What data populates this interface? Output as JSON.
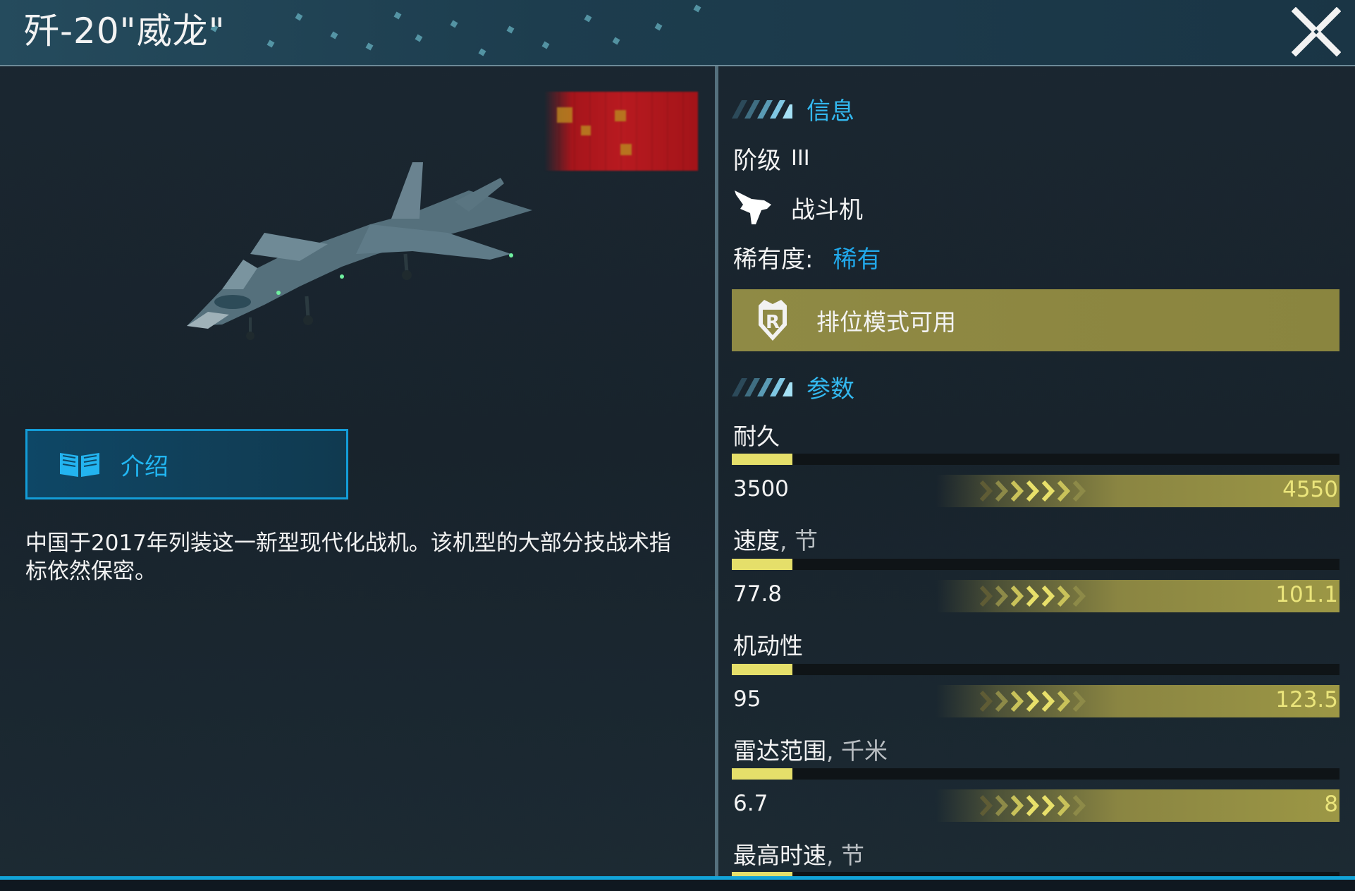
{
  "header": {
    "title": "歼-20\"威龙\""
  },
  "left_panel": {
    "intro_button_label": "介绍",
    "description": "中国于2017年列装这一新型现代化战机。该机型的大部分技战术指标依然保密。"
  },
  "info": {
    "section_label": "信息",
    "tier_label": "阶级",
    "tier_value": "III",
    "class_label": "战斗机",
    "rarity_label": "稀有度:",
    "rarity_value": "稀有",
    "ranked_label": "排位模式可用"
  },
  "params": {
    "section_label": "参数",
    "stats": [
      {
        "name": "耐久",
        "unit": "",
        "current": "3500",
        "max": "4550",
        "fill_fraction": 0.1
      },
      {
        "name": "速度",
        "unit": ", 节",
        "current": "77.8",
        "max": "101.1",
        "fill_fraction": 0.1
      },
      {
        "name": "机动性",
        "unit": "",
        "current": "95",
        "max": "123.5",
        "fill_fraction": 0.1
      },
      {
        "name": "雷达范围",
        "unit": ", 千米",
        "current": "6.7",
        "max": "8",
        "fill_fraction": 0.1
      },
      {
        "name": "最高时速",
        "unit": ", 节",
        "fill_fraction": 0.1
      }
    ]
  },
  "colors": {
    "accent_blue": "#21b6f2",
    "rarity_blue": "#21a8ea",
    "stat_fill_yellow": "#e5df6a",
    "ranked_banner": "#8f8a45"
  },
  "icons": [
    "close-icon",
    "book-icon",
    "fighter-jet-icon",
    "ranked-shield-icon",
    "stripes-icon",
    "chevrons-icon"
  ]
}
